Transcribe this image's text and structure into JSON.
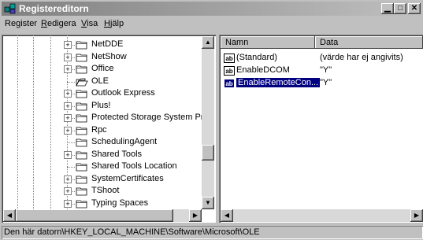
{
  "window": {
    "title": "Registereditorn",
    "icon": "regedit-icon",
    "controls": [
      "minimize",
      "maximize",
      "close"
    ]
  },
  "menu": {
    "items": [
      {
        "label": "Register",
        "underline": "g"
      },
      {
        "label": "Redigera",
        "underline": "R"
      },
      {
        "label": "Visa",
        "underline": "V"
      },
      {
        "label": "Hjälp",
        "underline": "H"
      }
    ]
  },
  "tree": {
    "items": [
      {
        "label": "NetDDE",
        "expandable": true
      },
      {
        "label": "NetShow",
        "expandable": true
      },
      {
        "label": "Office",
        "expandable": true
      },
      {
        "label": "OLE",
        "expandable": false,
        "open": true
      },
      {
        "label": "Outlook Express",
        "expandable": true
      },
      {
        "label": "Plus!",
        "expandable": true
      },
      {
        "label": "Protected Storage System Pr",
        "expandable": true
      },
      {
        "label": "Rpc",
        "expandable": true
      },
      {
        "label": "SchedulingAgent",
        "expandable": false
      },
      {
        "label": "Shared Tools",
        "expandable": true
      },
      {
        "label": "Shared Tools Location",
        "expandable": false
      },
      {
        "label": "SystemCertificates",
        "expandable": true
      },
      {
        "label": "TShoot",
        "expandable": true
      },
      {
        "label": "Typing Spaces",
        "expandable": true
      }
    ]
  },
  "list": {
    "columns": [
      "Namn",
      "Data"
    ],
    "rows": [
      {
        "name": "(Standard)",
        "data": "(värde har ej angivits)",
        "selected": false
      },
      {
        "name": "EnableDCOM",
        "data": "\"Y\"",
        "selected": false
      },
      {
        "name": "EnableRemoteCon...",
        "data": "\"Y\"",
        "selected": true
      }
    ]
  },
  "status": {
    "path": "Den här datorn\\HKEY_LOCAL_MACHINE\\Software\\Microsoft\\OLE"
  },
  "colors": {
    "selection": "#000080",
    "titlebar": "#808080",
    "face": "#c0c0c0"
  }
}
